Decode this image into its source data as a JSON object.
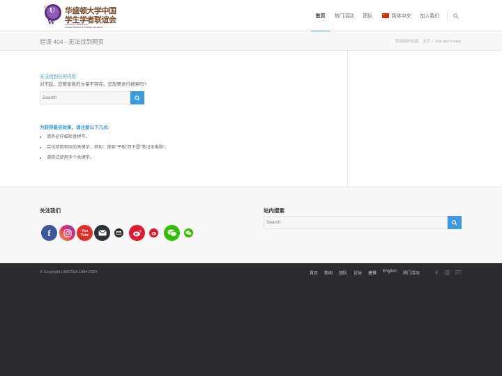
{
  "logo": {
    "cn_line1": "华盛顿大学中国",
    "cn_line2": "学生学者联谊会",
    "en_line1": "University of Washington",
    "en_line2": "Chinese Students & Scholars Association"
  },
  "nav": {
    "items": [
      {
        "label": "首页",
        "active": true
      },
      {
        "label": "热门活动"
      },
      {
        "label": "团队"
      },
      {
        "label": "简体中文",
        "icon": "china-flag-icon"
      },
      {
        "label": "加入我们"
      }
    ],
    "search_icon": "search-icon"
  },
  "titlebar": {
    "title": "错误 404 - 无法找到网页",
    "breadcrumb_prefix": "您现在的位置:",
    "breadcrumb_home": "主页",
    "breadcrumb_sep": "/",
    "breadcrumb_current": "404 Not Found"
  },
  "main": {
    "heading": "无法找到任何内容",
    "text": "对不起，您要查看的文章不存在。您想要进行搜索吗?",
    "search_placeholder": "Search",
    "tips_heading": "为获得最佳效果，请注意以下几点:",
    "tips": [
      "请务必仔细检查拼写。",
      "尝试使用相似的关键字，例如：搜索“平板”而不是“笔记本电脑”。",
      "请尝试使用多个关键字。"
    ]
  },
  "footer": {
    "follow_title": "关注我们",
    "social": [
      "facebook-icon",
      "instagram-icon",
      "youtube-icon",
      "email-icon",
      "mail-small-icon",
      "weibo-icon",
      "weibo-small-icon",
      "wechat-icon",
      "wechat-small-icon"
    ],
    "youtube_label": "You Tube",
    "site_search_title": "站内搜索",
    "search_placeholder": "Search"
  },
  "socket": {
    "copyright": "© Copyright UWCSSA 1984-2024",
    "nav": [
      "首页",
      "新闻",
      "团队",
      "论坛",
      "建推",
      "English",
      "热门活动"
    ],
    "social": [
      "facebook-icon",
      "instagram-icon",
      "youtube-icon"
    ]
  },
  "colors": {
    "accent": "#3c9be0",
    "footer_dark": "#2a2c30",
    "logo_brown": "#7b4c2a",
    "logo_purple": "#5a2d82"
  }
}
